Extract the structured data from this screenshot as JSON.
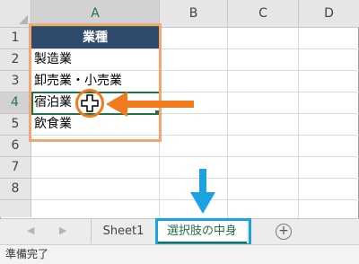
{
  "columns": [
    "A",
    "B",
    "C",
    "D"
  ],
  "rows": [
    "1",
    "2",
    "3",
    "4",
    "5",
    "6",
    "7",
    "8"
  ],
  "cells": {
    "header": "業種",
    "a2": "製造業",
    "a3": "卸売業・小売業",
    "a4": "宿泊業",
    "a5": "飲食業"
  },
  "tabs": {
    "prev_icon": "◀",
    "next_icon": "▶",
    "sheet1": "Sheet1",
    "active": "選択肢の中身",
    "add_icon": "+"
  },
  "status": "準備完了",
  "colors": {
    "header_fill": "#2f4b6b",
    "excel_green": "#217346",
    "annotation_orange": "#f07a1c",
    "highlight_orange": "#f4a672",
    "annotation_blue": "#1aa3e0"
  }
}
